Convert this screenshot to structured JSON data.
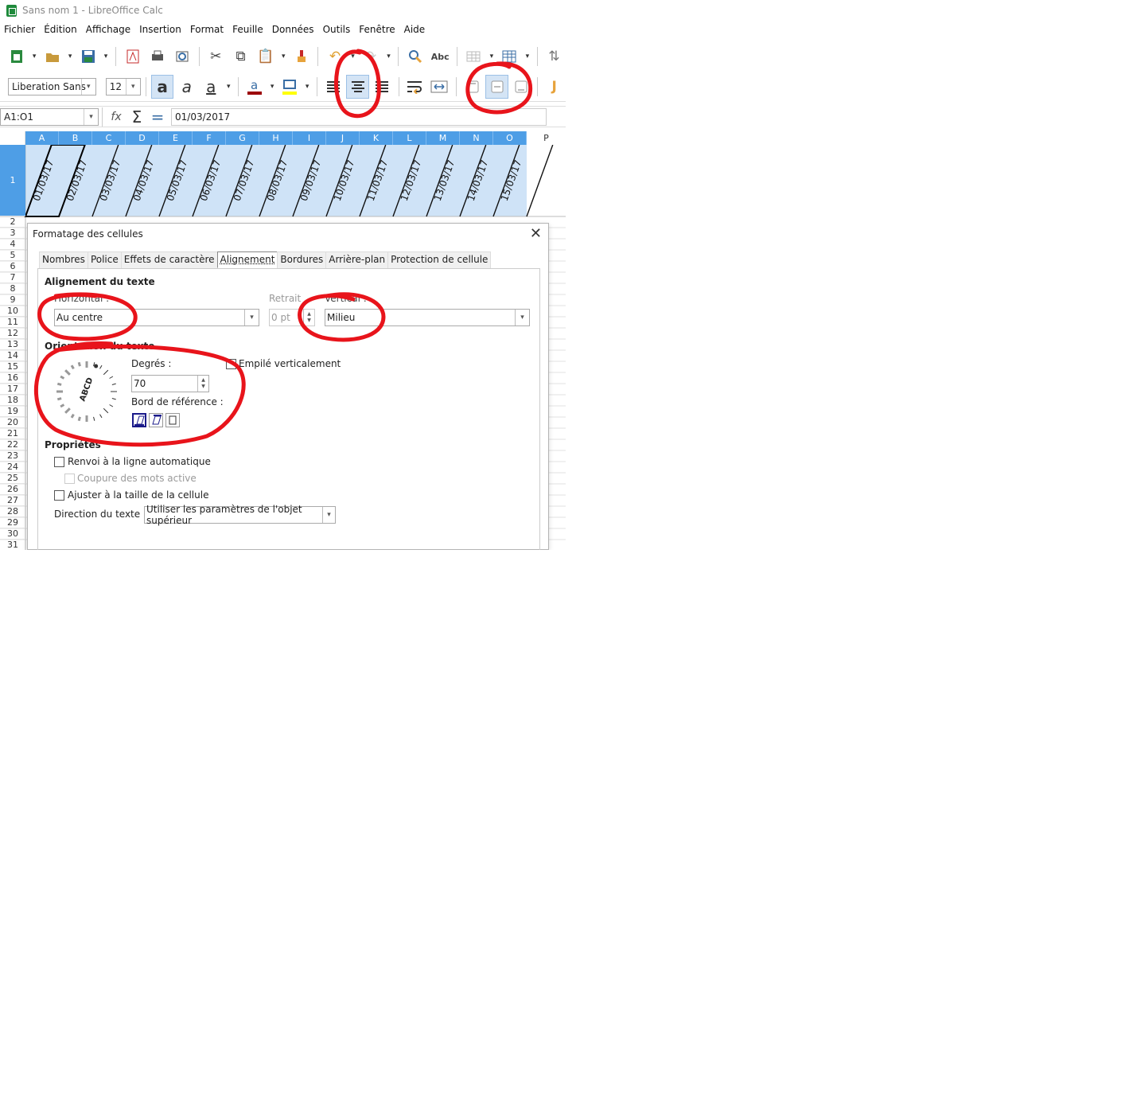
{
  "window": {
    "title": "Sans nom 1 - LibreOffice Calc"
  },
  "menu": [
    "Fichier",
    "Édition",
    "Affichage",
    "Insertion",
    "Format",
    "Feuille",
    "Données",
    "Outils",
    "Fenêtre",
    "Aide"
  ],
  "toolbar2": {
    "font_name": "Liberation Sans",
    "font_size": "12"
  },
  "formula_bar": {
    "name_box": "A1:O1",
    "formula": "01/03/2017"
  },
  "sheet": {
    "columns": [
      "A",
      "B",
      "C",
      "D",
      "E",
      "F",
      "G",
      "H",
      "I",
      "J",
      "K",
      "L",
      "M",
      "N",
      "O",
      "P"
    ],
    "rows": [
      "1",
      "2",
      "3",
      "4",
      "5",
      "6",
      "7",
      "8",
      "9",
      "10",
      "11",
      "12",
      "13",
      "14",
      "15",
      "16",
      "17",
      "18",
      "19",
      "20",
      "21",
      "22",
      "23",
      "24",
      "25",
      "26",
      "27",
      "28",
      "29",
      "30",
      "31"
    ],
    "row1_cells": [
      "01/03/17",
      "02/03/17",
      "03/03/17",
      "04/03/17",
      "05/03/17",
      "06/03/17",
      "07/03/17",
      "08/03/17",
      "09/03/17",
      "10/03/17",
      "11/03/17",
      "12/03/17",
      "13/03/17",
      "14/03/17",
      "15/03/17"
    ]
  },
  "dialog": {
    "title": "Formatage des cellules",
    "tabs": [
      "Nombres",
      "Police",
      "Effets de caractère",
      "Alignement",
      "Bordures",
      "Arrière-plan",
      "Protection de cellule"
    ],
    "selected_tab": "Alignement",
    "section_text_alignment": "Alignement du texte",
    "horizontal_label": "Horizontal :",
    "horizontal_value": "Au centre",
    "indent_label": "Retrait",
    "indent_value": "0 pt",
    "vertical_label": "Vertical :",
    "vertical_value": "Milieu",
    "orientation_label": "Orientation du texte",
    "degrees_label": "Degrés :",
    "degrees_value": "70",
    "dial_text": "ABCD",
    "stacked_label": "Empilé verticalement",
    "reference_edge_label": "Bord de référence :",
    "properties_label": "Propriétés",
    "wrap_label": "Renvoi à la ligne automatique",
    "hyphen_label": "Coupure des mots active",
    "shrink_label": "Ajuster à la taille de la cellule",
    "direction_label": "Direction du texte :",
    "direction_value": "Utiliser les paramètres de l'objet supérieur"
  },
  "annotation_color": "#e8141b"
}
